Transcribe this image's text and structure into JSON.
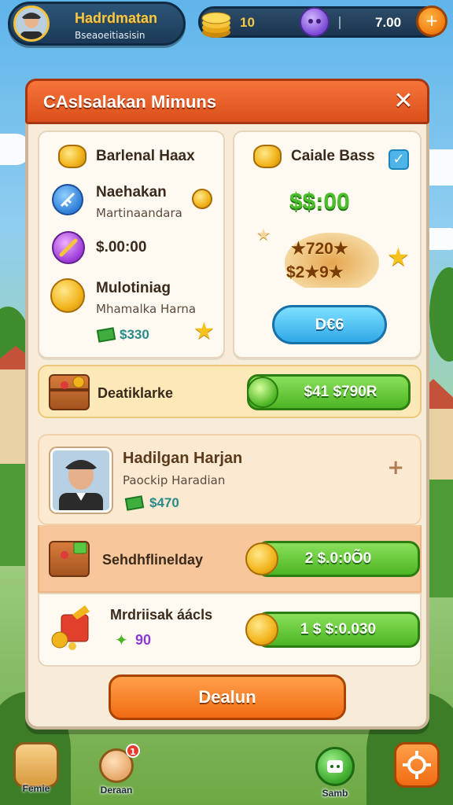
{
  "profile": {
    "name": "Hadrdmatan",
    "subtitle": "Bseaoeitiasisin"
  },
  "currency": {
    "coins": "10",
    "gems": "7.00",
    "add_label": "+"
  },
  "dialog": {
    "title": "CAslsalakan Mimuns",
    "close_label": "✕",
    "left_card": {
      "header": "Barlenal Haax",
      "items": [
        {
          "title": "Naehakan",
          "subtitle": "Martinaandara"
        },
        {
          "title": "$.00:00",
          "subtitle": ""
        },
        {
          "title": "Mulotiniag",
          "subtitle": "Mhamalka Harna"
        }
      ],
      "price": "$330"
    },
    "right_card": {
      "header": "Caiale Bass",
      "amount": "$$:00",
      "bonus_top": "★720★",
      "bonus_bottom": "$2★9★",
      "button_label": "D€6"
    },
    "rows": [
      {
        "title": "Deatiklarke",
        "button": "$41 $790R"
      },
      {
        "title": "Hadilgan Harjan",
        "subtitle": "Paockip Haradian",
        "price": "$470",
        "action": "+"
      },
      {
        "title": "Sehdhflinelday",
        "button": "2 $.0:0Õ0"
      },
      {
        "title": "Mrdriisak áácls",
        "price": "90",
        "button": "1 $ $:0.030"
      }
    ],
    "primary_button": "Dealun"
  },
  "nav": {
    "items": [
      {
        "label": "Femie"
      },
      {
        "label": "Deraan",
        "badge": "1"
      },
      {
        "label": "Samb"
      },
      {
        "label": ""
      }
    ]
  }
}
